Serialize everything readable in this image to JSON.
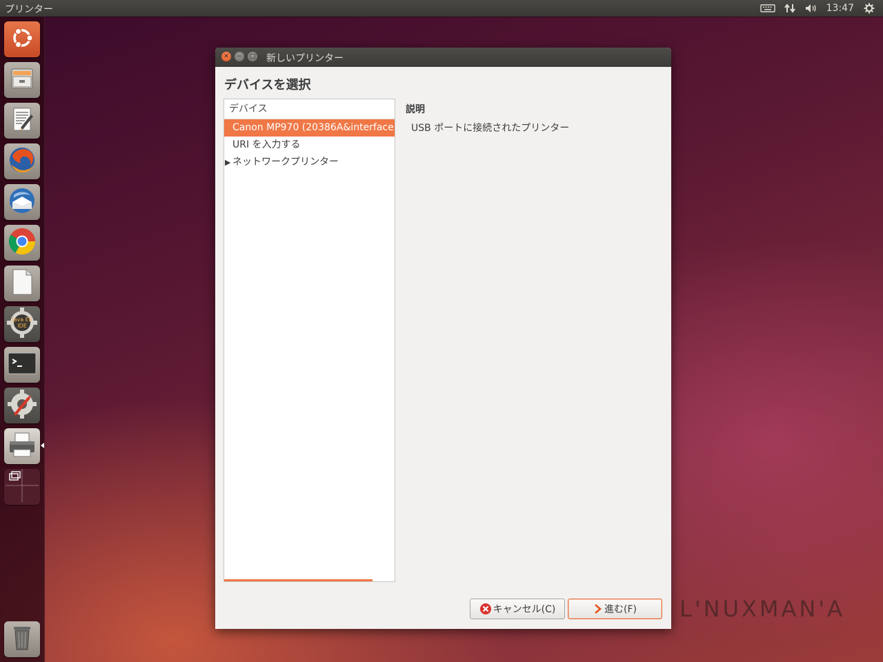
{
  "topbar": {
    "app_title": "プリンター",
    "clock": "13:47"
  },
  "launcher": {
    "items": [
      {
        "icon": "ubuntu-dash-icon"
      },
      {
        "icon": "file-manager-icon"
      },
      {
        "icon": "text-editor-icon"
      },
      {
        "icon": "firefox-icon"
      },
      {
        "icon": "thunderbird-icon"
      },
      {
        "icon": "chrome-icon"
      },
      {
        "icon": "libreoffice-icon"
      },
      {
        "icon": "java-ee-ide-icon",
        "label": "Java EE IDE"
      },
      {
        "icon": "terminal-icon"
      },
      {
        "icon": "system-settings-icon"
      },
      {
        "icon": "printer-icon"
      },
      {
        "icon": "workspace-switcher-icon"
      },
      {
        "icon": "trash-icon"
      }
    ]
  },
  "dialog": {
    "title": "新しいプリンター",
    "heading": "デバイスを選択",
    "device_column_header": "デバイス",
    "devices": [
      {
        "label": "Canon MP970 (20386A&interface",
        "selected": true
      },
      {
        "label": "URI を入力する",
        "selected": false
      },
      {
        "label": "ネットワークプリンター",
        "selected": false,
        "expandable": true
      }
    ],
    "description_label": "説明",
    "description_text": "USB ポートに接続されたプリンター",
    "cancel_button": "キャンセル(C)",
    "next_button": "進む(F)",
    "progress_fraction": 0.87
  },
  "watermark": "L'NUXMAN'A",
  "colors": {
    "accent": "#f07746",
    "titlebar": "#3c3b37",
    "dialog_bg": "#f2f1f0"
  }
}
